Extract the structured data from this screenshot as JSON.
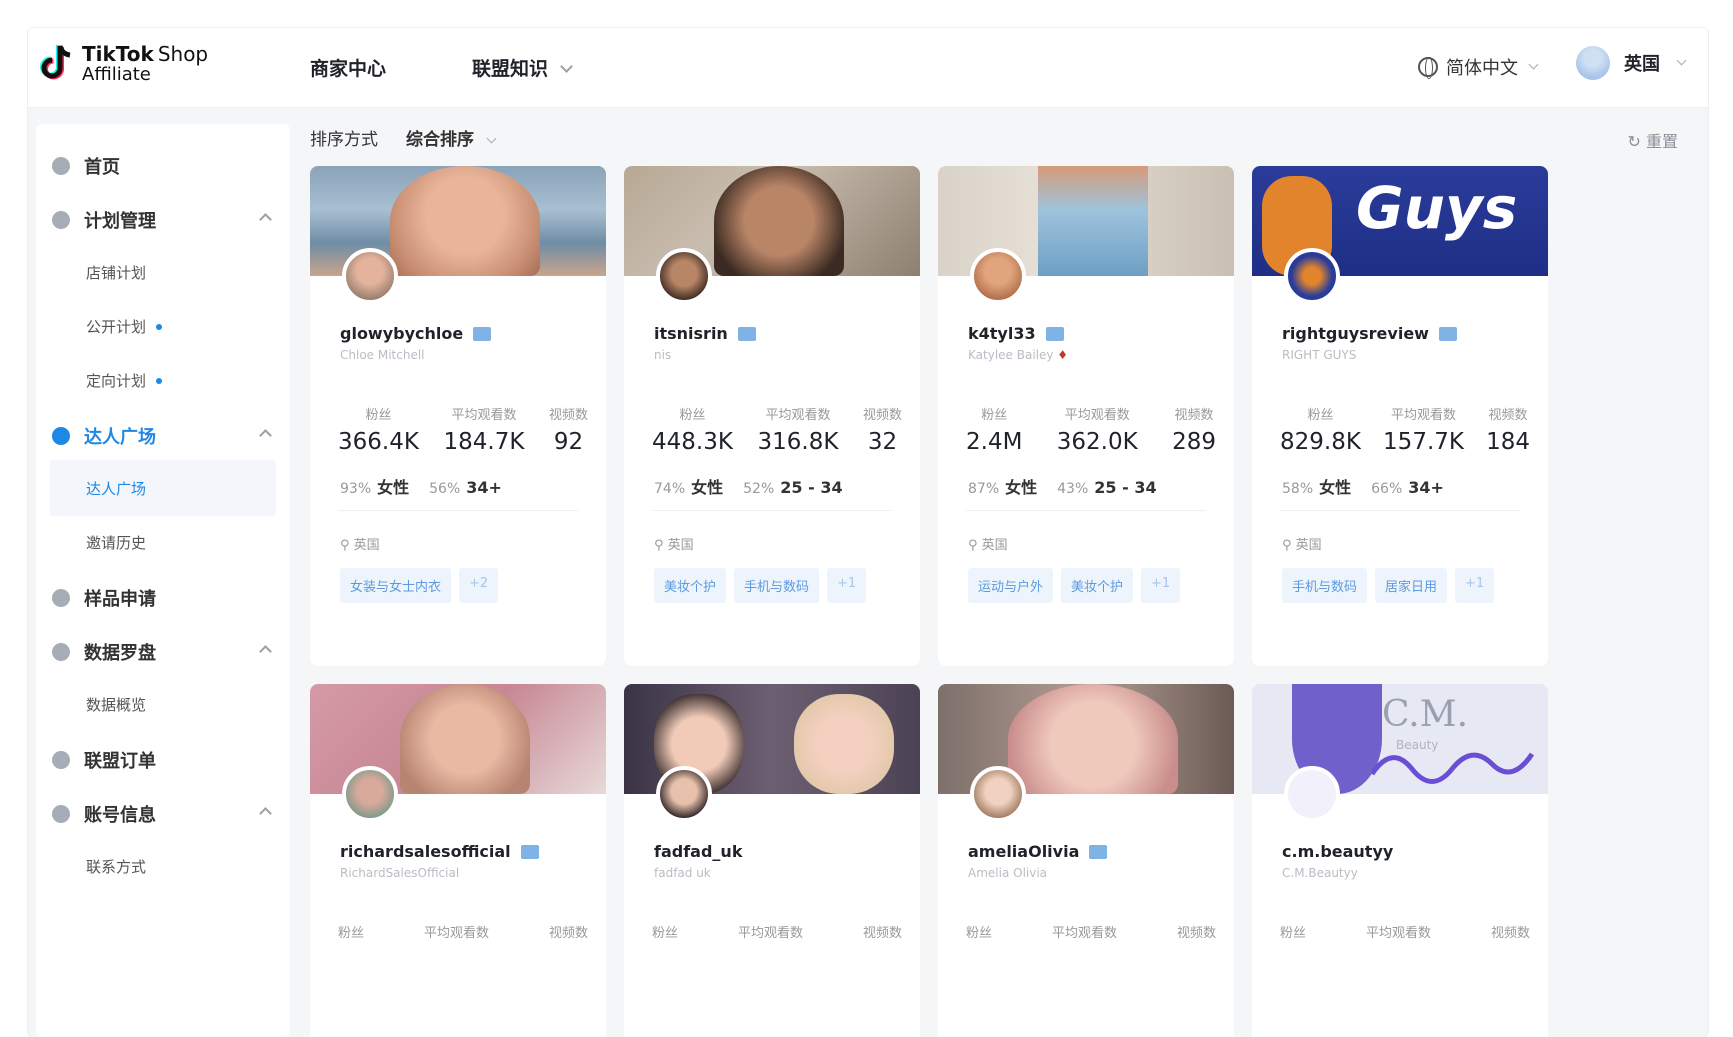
{
  "brand": {
    "line1": "TikTok",
    "line1b": "Shop",
    "line2": "Affiliate"
  },
  "nav": {
    "merchant_center": "商家中心",
    "alliance_knowledge": "联盟知识"
  },
  "header": {
    "language": "简体中文",
    "region": "英国"
  },
  "sidebar": {
    "home": "首页",
    "plan_mgmt": "计划管理",
    "store_plan": "店铺计划",
    "public_plan": "公开计划",
    "targeted_plan": "定向计划",
    "creator_square": "达人广场",
    "creator_square_sub": "达人广场",
    "invite_history": "邀请历史",
    "sample_request": "样品申请",
    "data_compass": "数据罗盘",
    "data_overview": "数据概览",
    "alliance_orders": "联盟订单",
    "account_info": "账号信息",
    "contact": "联系方式"
  },
  "sort": {
    "label": "排序方式",
    "value": "综合排序",
    "reset": "重置"
  },
  "stat_labels": {
    "fans": "粉丝",
    "avg_views": "平均观看数",
    "videos": "视频数"
  },
  "cards": [
    {
      "username": "glowybychloe",
      "nickname": "Chloe Mitchell",
      "fans": "366.4K",
      "avg_views": "184.7K",
      "videos": "92",
      "female_pct": "93%",
      "gender": "女性",
      "age_pct": "56%",
      "age": "34+",
      "location": "英国",
      "tags": [
        "女装与女士内衣"
      ],
      "more": "+2"
    },
    {
      "username": "itsnisrin",
      "nickname": "nis",
      "fans": "448.3K",
      "avg_views": "316.8K",
      "videos": "32",
      "female_pct": "74%",
      "gender": "女性",
      "age_pct": "52%",
      "age": "25 - 34",
      "location": "英国",
      "tags": [
        "美妆个护",
        "手机与数码"
      ],
      "more": "+1"
    },
    {
      "username": "k4tyl33",
      "nickname": "Katylee Bailey",
      "fans": "2.4M",
      "avg_views": "362.0K",
      "videos": "289",
      "female_pct": "87%",
      "gender": "女性",
      "age_pct": "43%",
      "age": "25 - 34",
      "location": "英国",
      "tags": [
        "运动与户外",
        "美妆个护"
      ],
      "more": "+1"
    },
    {
      "username": "rightguysreview",
      "nickname": "RIGHT GUYS",
      "fans": "829.8K",
      "avg_views": "157.7K",
      "videos": "184",
      "female_pct": "58%",
      "gender": "女性",
      "age_pct": "66%",
      "age": "34+",
      "location": "英国",
      "tags": [
        "手机与数码",
        "居家日用"
      ],
      "more": "+1",
      "cover_text": "Guys"
    },
    {
      "username": "richardsalesofficial",
      "nickname": "RichardSalesOfficial"
    },
    {
      "username": "fadfad_uk",
      "nickname": "fadfad uk"
    },
    {
      "username": "ameliaOlivia",
      "nickname": "Amelia Olivia"
    },
    {
      "username": "c.m.beautyy",
      "nickname": "C.M.Beautyy",
      "cover_text": "C.M.",
      "cover_sub": "Beauty"
    }
  ],
  "colors": {
    "accent": "#1e88e5",
    "tag_bg": "#eef4fb",
    "tag_text": "#5c9ae0"
  }
}
